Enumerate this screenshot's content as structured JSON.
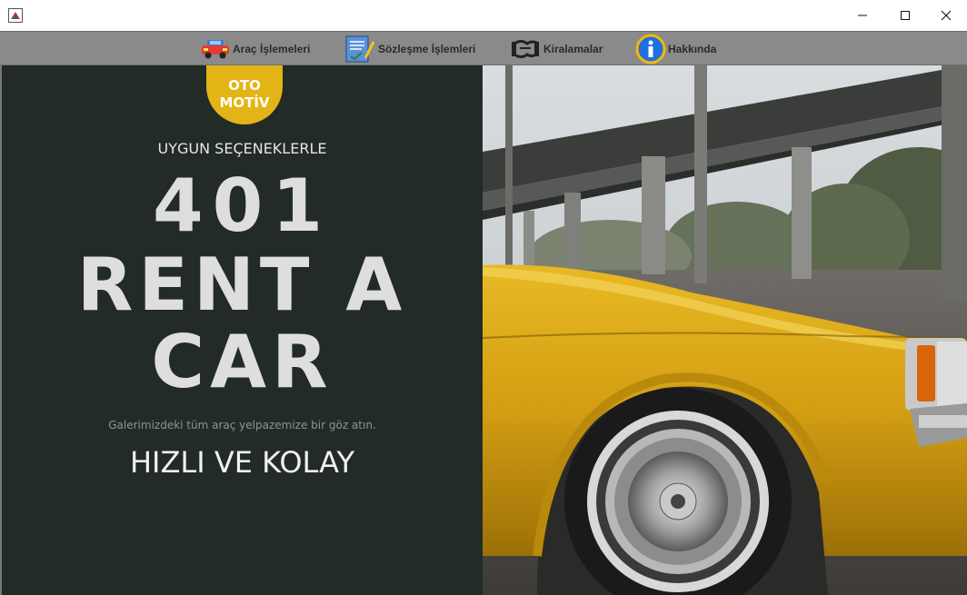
{
  "window": {
    "title": ""
  },
  "menu": {
    "items": [
      {
        "label": "Araç İşlemeleri",
        "icon": "car-icon"
      },
      {
        "label": "Sözleşme İşlemleri",
        "icon": "contract-icon"
      },
      {
        "label": "Kiralamalar",
        "icon": "handshake-icon"
      },
      {
        "label": "Hakkında",
        "icon": "info-icon"
      }
    ]
  },
  "hero": {
    "badge_line1": "OTO",
    "badge_line2": "MOTİV",
    "tagline": "UYGUN SEÇENEKLERLE",
    "title_line1": "401",
    "title_line2": "RENT A",
    "title_line3": "CAR",
    "subtitle": "Galerimizdeki tüm araç yelpazemize bir göz atın.",
    "slogan": "HIZLI VE KOLAY"
  },
  "colors": {
    "panel_bg": "#222b26",
    "badge_yellow": "#e3b416",
    "menubar_gray": "#8a8a8a",
    "car_yellow": "#d9a81a"
  }
}
